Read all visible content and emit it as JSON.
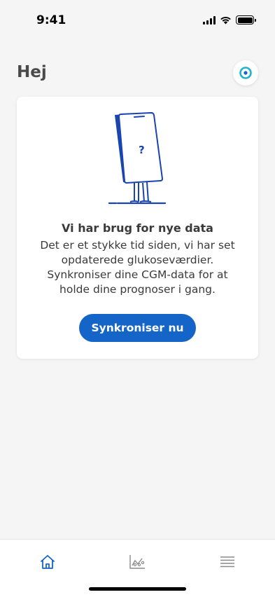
{
  "status_bar": {
    "time": "9:41",
    "icons": [
      "cellular-signal-icon",
      "wifi-icon",
      "battery-icon"
    ]
  },
  "header": {
    "greeting": "Hej",
    "cgm_icon": "cgm-sensor-icon"
  },
  "card": {
    "illustration": "phone-question-mark-illustration",
    "title": "Vi har brug for nye data",
    "body": "Det er et stykke tid siden, vi har set opdaterede glukoseværdier. Synkroniser dine CGM-data for at holde dine prognoser i gang.",
    "button_label": "Synkroniser nu"
  },
  "tab_bar": {
    "tabs": [
      {
        "icon": "home-icon",
        "active": true
      },
      {
        "icon": "chart-icon",
        "active": false
      },
      {
        "icon": "menu-icon",
        "active": false
      }
    ]
  },
  "colors": {
    "accent": "#1565c8",
    "cgm_accent": "#1fb5c8",
    "background": "#f5f5f5",
    "text": "#3a3a3a"
  }
}
